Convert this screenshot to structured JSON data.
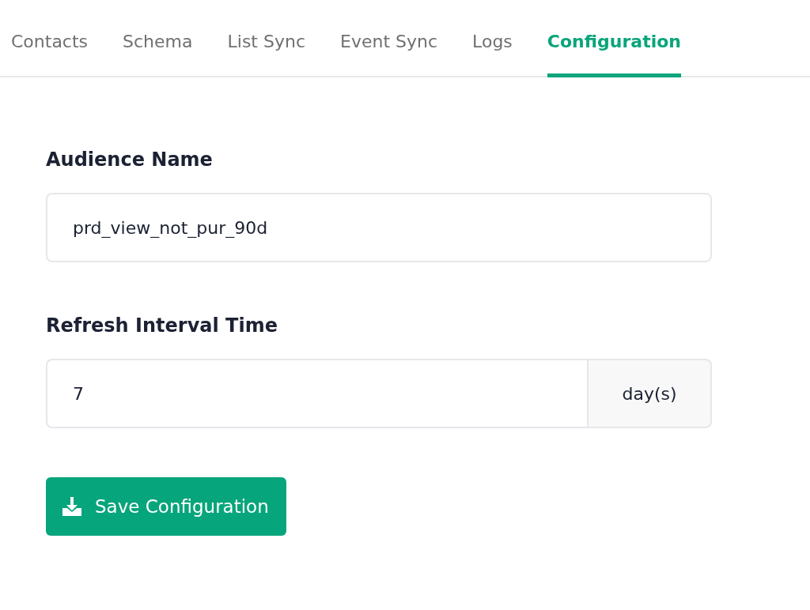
{
  "tabs": [
    {
      "label": "Contacts",
      "selected": false
    },
    {
      "label": "Schema",
      "selected": false
    },
    {
      "label": "List Sync",
      "selected": false
    },
    {
      "label": "Event Sync",
      "selected": false
    },
    {
      "label": "Logs",
      "selected": false
    },
    {
      "label": "Configuration",
      "selected": true
    }
  ],
  "form": {
    "fields": [
      {
        "kind": "text",
        "label": "Audience Name",
        "value": "prd_view_not_pur_90d"
      },
      {
        "kind": "addon",
        "label": "Refresh Interval Time",
        "value": "7",
        "addon": "day(s)"
      }
    ],
    "save_button": "Save Configuration"
  }
}
